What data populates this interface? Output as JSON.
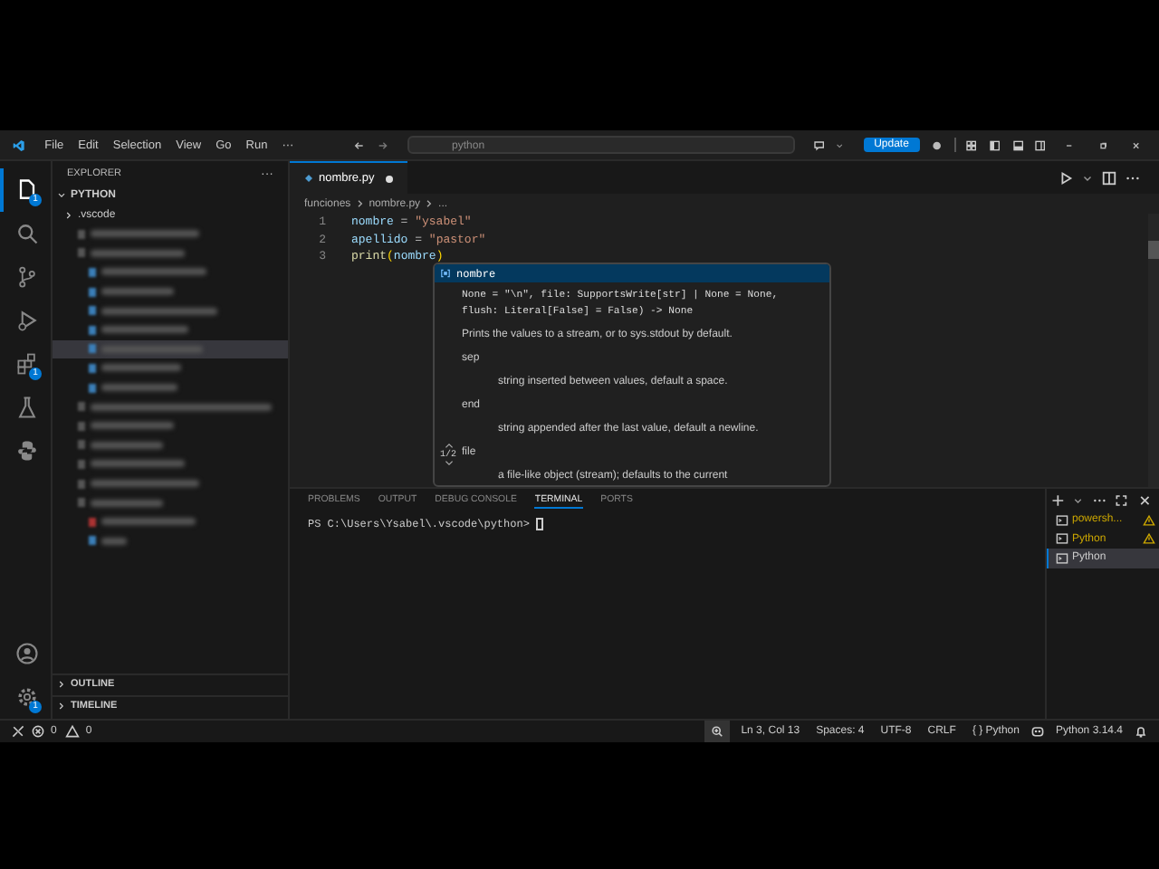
{
  "title_bar": {
    "menus": [
      "File",
      "Edit",
      "Selection",
      "View",
      "Go",
      "Run",
      "···"
    ],
    "search": "python",
    "update_button": "Update"
  },
  "activity_bar": {
    "items": [
      {
        "kind": "explorer",
        "selected": true,
        "badge": "1"
      },
      {
        "kind": "search",
        "selected": false
      },
      {
        "kind": "source-control",
        "selected": false
      },
      {
        "kind": "run",
        "selected": false
      },
      {
        "kind": "extensions",
        "selected": false,
        "badge": "1"
      },
      {
        "kind": "testing",
        "selected": false
      },
      {
        "kind": "python",
        "selected": false
      }
    ],
    "bottom": [
      {
        "kind": "account"
      },
      {
        "kind": "settings",
        "badge": "1"
      }
    ]
  },
  "sidebar": {
    "title": "EXPLORER",
    "more": "···",
    "root": "PYTHON",
    "folder": ".vscode",
    "hidden_items": [
      {
        "kind": "folder",
        "selected": false
      },
      {
        "kind": "folder",
        "selected": false
      },
      {
        "kind": "file",
        "selected": false
      },
      {
        "kind": "file",
        "selected": false
      },
      {
        "kind": "file",
        "selected": false
      },
      {
        "kind": "file",
        "selected": false
      },
      {
        "kind": "file",
        "selected": true
      },
      {
        "kind": "file",
        "selected": false
      },
      {
        "kind": "file",
        "selected": false
      },
      {
        "kind": "folder",
        "selected": false
      },
      {
        "kind": "folder",
        "selected": false
      },
      {
        "kind": "folder",
        "selected": false
      },
      {
        "kind": "folder",
        "selected": false
      },
      {
        "kind": "folder",
        "selected": false
      },
      {
        "kind": "folder",
        "selected": false
      },
      {
        "kind": "error",
        "selected": false
      },
      {
        "kind": "file",
        "selected": false
      }
    ],
    "sections": [
      "OUTLINE",
      "TIMELINE"
    ]
  },
  "editor": {
    "tab": {
      "label": "nombre.py",
      "modified": true
    },
    "breadcrumb": [
      "funciones",
      "nombre.py",
      "..."
    ],
    "lines": [
      {
        "number": "1",
        "tokens": [
          {
            "text": "nombre",
            "kind": "var"
          },
          {
            "text": " = ",
            "kind": "op"
          },
          {
            "text": "\"ysabel\"",
            "kind": "str"
          }
        ]
      },
      {
        "number": "2",
        "tokens": [
          {
            "text": "apellido",
            "kind": "var"
          },
          {
            "text": " = ",
            "kind": "op"
          },
          {
            "text": "\"pastor\"",
            "kind": "str"
          }
        ]
      },
      {
        "number": "3",
        "tokens": [
          {
            "text": "print",
            "kind": "fn"
          },
          {
            "text": "(",
            "kind": "paren"
          },
          {
            "text": "nombre",
            "kind": "var"
          },
          {
            "text": ")",
            "kind": "paren"
          }
        ]
      }
    ],
    "hover": {
      "suggestion": "nombre",
      "selected": true,
      "signature": [
        "None = \"\\n\", file: SupportsWrite[str] | None = None,",
        "flush: Literal[False] = False) -> None"
      ],
      "doc": [
        {
          "kind": "para",
          "text": "Prints the values to a stream, or to sys.stdout by default."
        },
        {
          "kind": "term",
          "text": "sep"
        },
        {
          "kind": "desc",
          "text": "string inserted between values, default a space."
        },
        {
          "kind": "term",
          "text": "end"
        },
        {
          "kind": "desc",
          "text": "string appended after the last value, default a newline."
        },
        {
          "kind": "term",
          "text": "file"
        },
        {
          "kind": "desc",
          "text": "a file-like object (stream); defaults to the current"
        }
      ],
      "counter": "1/2"
    }
  },
  "panel": {
    "tabs": [
      {
        "label": "PROBLEMS",
        "selected": false
      },
      {
        "label": "OUTPUT",
        "selected": false
      },
      {
        "label": "DEBUG CONSOLE",
        "selected": false
      },
      {
        "label": "TERMINAL",
        "selected": true
      },
      {
        "label": "PORTS",
        "selected": false
      }
    ],
    "terminal_line": "PS C:\\Users\\Ysabel\\.vscode\\python> ",
    "terminals": [
      {
        "label": "powersh...",
        "warning": true,
        "selected": false
      },
      {
        "label": "Python",
        "warning": true,
        "selected": false
      },
      {
        "label": "Python",
        "warning": false,
        "selected": true
      }
    ]
  },
  "status_bar": {
    "errors": "0",
    "warnings": "0",
    "items": [
      {
        "kind": "zoom"
      },
      {
        "kind": "text",
        "text": "Ln 3, Col 13"
      },
      {
        "kind": "text",
        "text": "Spaces: 4"
      },
      {
        "kind": "text",
        "text": "UTF-8"
      },
      {
        "kind": "text",
        "text": "CRLF"
      },
      {
        "kind": "text",
        "text": "{ } Python"
      },
      {
        "kind": "copilot"
      },
      {
        "kind": "text",
        "text": "Python 3.14.4"
      },
      {
        "kind": "bell"
      }
    ]
  }
}
